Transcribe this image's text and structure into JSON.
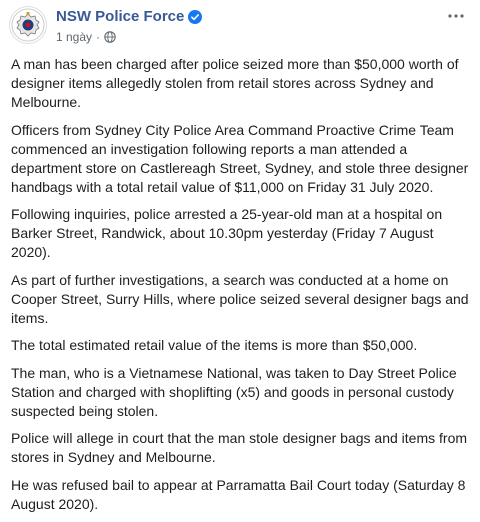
{
  "post": {
    "page_name": "NSW Police Force",
    "timestamp": "1 ngày",
    "separator": "·",
    "paragraphs": [
      "A man has been charged after police seized more than $50,000 worth of designer items allegedly stolen from retail stores across Sydney and Melbourne.",
      "Officers from Sydney City Police Area Command Proactive Crime Team commenced an investigation following reports a man attended a department store on Castlereagh Street, Sydney, and stole three designer handbags with a total retail value of $11,000 on Friday 31 July 2020.",
      "Following inquiries, police arrested a 25-year-old man at a hospital on Barker Street, Randwick, about 10.30pm yesterday (Friday 7 August 2020).",
      "As part of further investigations, a search was conducted at a home on Cooper Street, Surry Hills, where police seized several designer bags and items.",
      "The total estimated retail value of the items is more than $50,000.",
      "The man, who is a Vietnamese National, was taken to Day Street Police Station and charged with shoplifting (x5) and goods in personal custody suspected being stolen.",
      "Police will allege in court that the man stole designer bags and items from stores in Sydney and Melbourne.",
      "He was refused bail to appear at Parramatta Bail Court today (Saturday 8 August 2020)."
    ]
  },
  "icons": {
    "avatar": "nsw-police-logo-icon",
    "verified": "verified-badge-icon",
    "audience": "globe-icon",
    "more": "more-options-icon"
  },
  "colors": {
    "page_name": "#385898",
    "verified": "#1877f2",
    "meta_text": "#606770",
    "body_text": "#1c1e21"
  }
}
